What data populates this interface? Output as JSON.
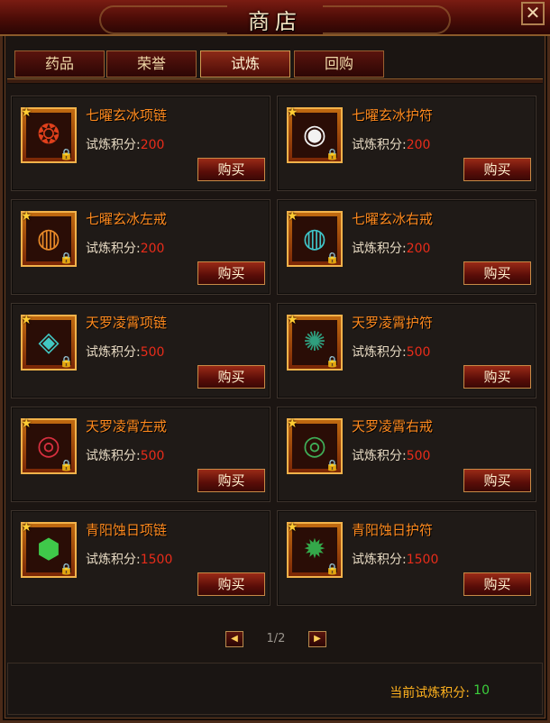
{
  "window": {
    "title": "商店",
    "close_label": "✕"
  },
  "tabs": [
    {
      "label": "药品",
      "active": false
    },
    {
      "label": "荣誉",
      "active": false
    },
    {
      "label": "试炼",
      "active": true
    },
    {
      "label": "回购",
      "active": false
    }
  ],
  "cost_label": "试炼积分:",
  "buy_label": "购买",
  "items": [
    {
      "name": "七曜玄冰项链",
      "cost": "200",
      "icon": "necklace-icon",
      "glyph": "❂",
      "glyph_color": "#e0401c"
    },
    {
      "name": "七曜玄冰护符",
      "cost": "200",
      "icon": "amulet-icon",
      "glyph": "◉",
      "glyph_color": "#f2f2f2"
    },
    {
      "name": "七曜玄冰左戒",
      "cost": "200",
      "icon": "ring-icon",
      "glyph": "◍",
      "glyph_color": "#e98a28"
    },
    {
      "name": "七曜玄冰右戒",
      "cost": "200",
      "icon": "ring-icon",
      "glyph": "◍",
      "glyph_color": "#3fc4c8"
    },
    {
      "name": "天罗凌霄项链",
      "cost": "500",
      "icon": "necklace-icon",
      "glyph": "◈",
      "glyph_color": "#42c7c2"
    },
    {
      "name": "天罗凌霄护符",
      "cost": "500",
      "icon": "amulet-icon",
      "glyph": "✺",
      "glyph_color": "#2f9e7e"
    },
    {
      "name": "天罗凌霄左戒",
      "cost": "500",
      "icon": "ring-icon",
      "glyph": "◎",
      "glyph_color": "#d83040"
    },
    {
      "name": "天罗凌霄右戒",
      "cost": "500",
      "icon": "ring-icon",
      "glyph": "◎",
      "glyph_color": "#3fae58"
    },
    {
      "name": "青阳蚀日项链",
      "cost": "1500",
      "icon": "necklace-icon",
      "glyph": "⬢",
      "glyph_color": "#3fc84a"
    },
    {
      "name": "青阳蚀日护符",
      "cost": "1500",
      "icon": "amulet-icon",
      "glyph": "✹",
      "glyph_color": "#34a84a"
    }
  ],
  "pager": {
    "text": "1/2",
    "prev_glyph": "◀",
    "next_glyph": "▶"
  },
  "footer": {
    "points_label": "当前试炼积分:",
    "points_value": "10"
  }
}
